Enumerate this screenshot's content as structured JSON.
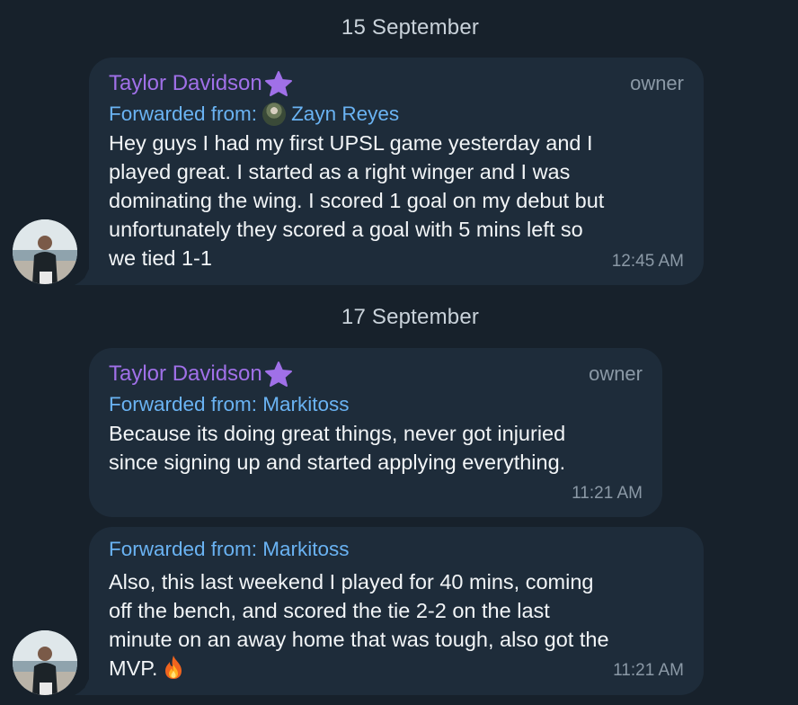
{
  "dates": [
    "15 September",
    "17 September"
  ],
  "messages": [
    {
      "sender": "Taylor Davidson",
      "role": "owner",
      "forwarded_label": "Forwarded from:",
      "forwarded_from": "Zayn Reyes",
      "lines": [
        "Hey guys I had my first UPSL game yesterday and I",
        "played great. I started as a right winger and I was",
        "dominating the wing. I scored 1 goal on my debut but",
        "unfortunately they scored a goal with 5 mins left so",
        "we tied 1-1"
      ],
      "time": "12:45 AM"
    },
    {
      "sender": "Taylor Davidson",
      "role": "owner",
      "forwarded_text": "Forwarded from: Markitoss",
      "lines": [
        "Because its doing great things, never got injuried",
        "since signing up and started applying everything."
      ],
      "time": "11:21 AM"
    },
    {
      "forwarded_text": "Forwarded from: Markitoss",
      "lines": [
        "Also, this last weekend I played for 40 mins, coming",
        "off the bench, and scored the tie 2-2 on the last",
        "minute on an away home that was tough, also got the",
        "MVP."
      ],
      "time": "11:21 AM"
    }
  ],
  "icons": {
    "sender_badge": "star-icon",
    "emoji": "fire-emoji"
  },
  "colors": {
    "background": "#17212b",
    "bubble": "#1e2c3a",
    "sender": "#a070e8",
    "link": "#6ab3f3",
    "meta": "#8b99a6"
  }
}
